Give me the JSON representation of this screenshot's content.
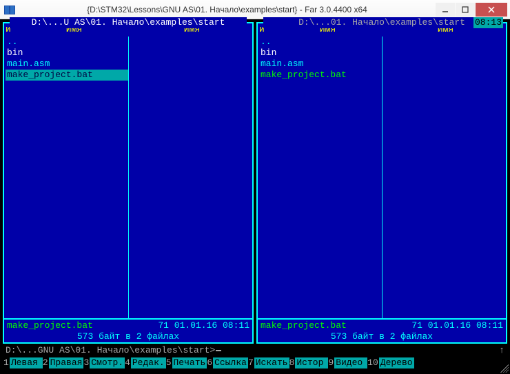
{
  "window": {
    "title": "{D:\\STM32\\Lessons\\GNU AS\\01. Начало\\examples\\start} - Far 3.0.4400 x64"
  },
  "clock": "08:13",
  "panels": {
    "left": {
      "path": " D:\\...U AS\\01. Начало\\examples\\start ",
      "sort_letter": "и",
      "col1_header": "Имя",
      "col2_header": "Имя",
      "files": [
        {
          "name": "..",
          "cls": "up"
        },
        {
          "name": "bin",
          "cls": "dir"
        },
        {
          "name": "main.asm",
          "cls": ""
        },
        {
          "name": "make_project.bat",
          "cls": "batch selected"
        }
      ],
      "footer_name": "make_project.bat",
      "footer_cls": "",
      "footer_info": "71 01.01.16 08:11",
      "summary": " 573 байт в 2 файлах "
    },
    "right": {
      "path": " D:\\...01. Начало\\examples\\start ",
      "sort_letter": "и",
      "col1_header": "Имя",
      "col2_header": "Имя",
      "files": [
        {
          "name": "..",
          "cls": "up"
        },
        {
          "name": "bin",
          "cls": "dir"
        },
        {
          "name": "main.asm",
          "cls": ""
        },
        {
          "name": "make_project.bat",
          "cls": "batch"
        }
      ],
      "footer_name": "make_project.bat",
      "footer_cls": "",
      "footer_info": "71 01.01.16 08:11",
      "summary": " 573 байт в 2 файлах "
    }
  },
  "cmdline": {
    "prompt": "D:\\...GNU AS\\01. Начало\\examples\\start>"
  },
  "fkeys": [
    {
      "n": "1",
      "label": "Левая "
    },
    {
      "n": "2",
      "label": "Правая"
    },
    {
      "n": "3",
      "label": "Смотр."
    },
    {
      "n": "4",
      "label": "Редак."
    },
    {
      "n": "5",
      "label": "Печать"
    },
    {
      "n": "6",
      "label": "Ссылка"
    },
    {
      "n": "7",
      "label": "Искать"
    },
    {
      "n": "8",
      "label": "Истор "
    },
    {
      "n": "9",
      "label": "Видео "
    },
    {
      "n": "10",
      "label": "Дерево"
    }
  ]
}
